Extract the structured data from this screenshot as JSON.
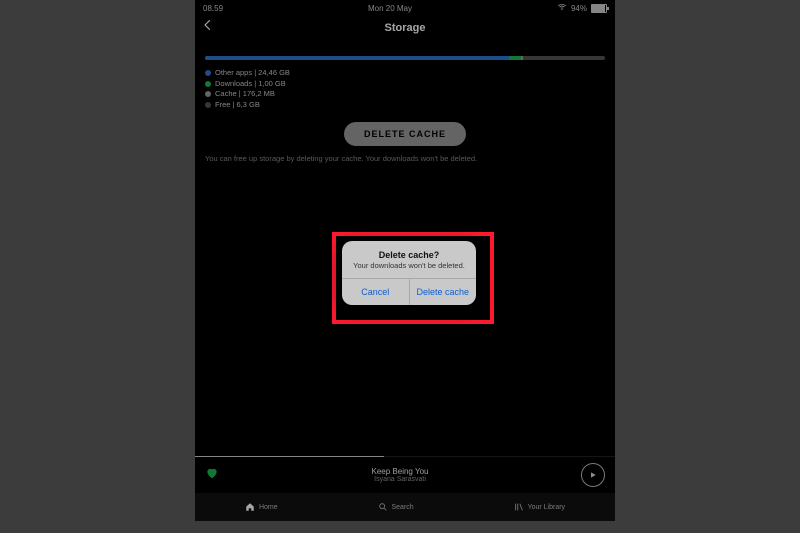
{
  "status": {
    "time": "08.59",
    "date": "Mon 20 May",
    "battery": "94%"
  },
  "nav": {
    "title": "Storage"
  },
  "bar": {
    "other_style": "width:76%;background:#2e77d0",
    "downloads_style": "width:3%;background:#1db954",
    "cache_style": "width:0.5%;background:#9b9b9b"
  },
  "legend": [
    "Other apps | 24,46 GB",
    "Downloads | 1,00 GB",
    "Cache | 176,2 MB",
    "Free | 6,3 GB"
  ],
  "main": {
    "delete_cache_btn": "DELETE CACHE",
    "hint": "You can free up storage by deleting your cache. Your downloads won't be deleted."
  },
  "dialog": {
    "title": "Delete cache?",
    "message": "Your downloads won't be deleted.",
    "cancel": "Cancel",
    "confirm": "Delete cache"
  },
  "player": {
    "title": "Keep Being You",
    "artist": "Isyana Sarasvati"
  },
  "tabs": [
    "Home",
    "Search",
    "Your Library"
  ],
  "colors": {
    "accent": "#1db954",
    "blue": "#2e77d0",
    "ios_action": "#0b5fd6",
    "highlight": "#ff1a2f"
  }
}
